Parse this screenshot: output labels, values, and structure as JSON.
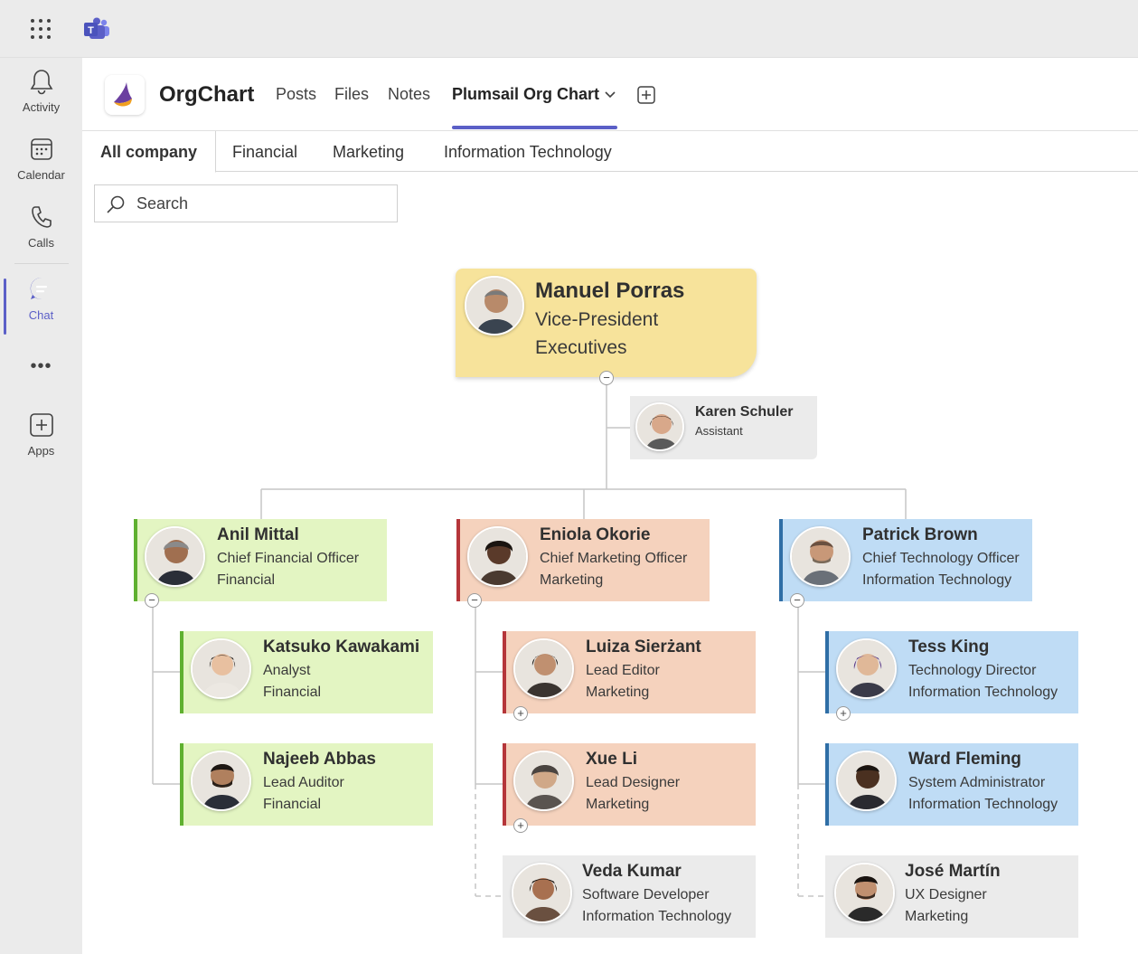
{
  "topbar": {
    "waffle_icon": "waffle-icon",
    "logo_icon": "teams-logo-icon"
  },
  "rail": {
    "items": [
      {
        "label": "Activity",
        "icon": "bell-icon"
      },
      {
        "label": "Calendar",
        "icon": "calendar-icon"
      },
      {
        "label": "Calls",
        "icon": "phone-icon"
      },
      {
        "label": "Chat",
        "icon": "chat-icon"
      },
      {
        "label": "Apps",
        "icon": "add-app-icon"
      }
    ],
    "more": "•••",
    "active": "Chat",
    "accent": "#5b5fc7"
  },
  "header": {
    "app_title": "OrgChart",
    "tabs": [
      "Posts",
      "Files",
      "Notes",
      "Plumsail Org Chart"
    ],
    "active_tab": "Plumsail Org Chart"
  },
  "subtabs": [
    "All company",
    "Financial",
    "Marketing",
    "Information Technology"
  ],
  "search": {
    "placeholder": "Search",
    "value": ""
  },
  "org": {
    "root": {
      "name": "Manuel Porras",
      "title": "Vice-President",
      "dept": "Executives"
    },
    "assistant": {
      "name": "Karen Schuler",
      "title": "Assistant"
    },
    "heads": [
      {
        "name": "Anil Mittal",
        "title": "Chief Financial Officer",
        "dept": "Financial"
      },
      {
        "name": "Eniola Okorie",
        "title": "Chief Marketing Officer",
        "dept": "Marketing"
      },
      {
        "name": "Patrick Brown",
        "title": "Chief Technology Officer",
        "dept": "Information Technology"
      }
    ],
    "financial": [
      {
        "name": "Katsuko Kawakami",
        "title": "Analyst",
        "dept": "Financial"
      },
      {
        "name": "Najeeb Abbas",
        "title": "Lead Auditor",
        "dept": "Financial"
      }
    ],
    "marketing": [
      {
        "name": "Luiza Sierżant",
        "title": "Lead Editor",
        "dept": "Marketing"
      },
      {
        "name": "Xue Li",
        "title": "Lead Designer",
        "dept": "Marketing"
      },
      {
        "name": "Veda Kumar",
        "title": "Software Developer",
        "dept": "Information Technology"
      }
    ],
    "it": [
      {
        "name": "Tess King",
        "title": "Technology Director",
        "dept": "Information Technology"
      },
      {
        "name": "Ward Fleming",
        "title": "System Administrator",
        "dept": "Information Technology"
      },
      {
        "name": "José Martín",
        "title": "UX Designer",
        "dept": "Marketing"
      }
    ],
    "colors": {
      "executive": "#f7e39b",
      "financial": "#e3f5c2",
      "marketing": "#f5d2bd",
      "it": "#bfdcf5",
      "other": "#ebebeb"
    }
  }
}
